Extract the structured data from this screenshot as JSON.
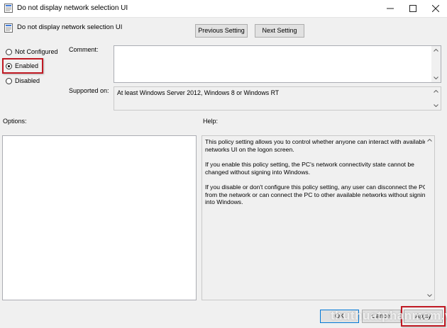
{
  "window": {
    "title": "Do not display network selection UI",
    "minimize_icon": "minimize-icon",
    "maximize_icon": "maximize-icon",
    "close_icon": "close-icon"
  },
  "header": {
    "policy_name": "Do not display network selection UI",
    "previous_setting_label": "Previous Setting",
    "next_setting_label": "Next Setting"
  },
  "state": {
    "options": [
      {
        "label": "Not Configured",
        "checked": false
      },
      {
        "label": "Enabled",
        "checked": true
      },
      {
        "label": "Disabled",
        "checked": false
      }
    ],
    "highlight_color": "#c01923"
  },
  "comment": {
    "label": "Comment:",
    "value": ""
  },
  "supported": {
    "label": "Supported on:",
    "value": "At least Windows Server 2012, Windows 8 or Windows RT"
  },
  "options_pane": {
    "label": "Options:"
  },
  "help": {
    "label": "Help:",
    "paragraphs": [
      "This policy setting allows you to control whether anyone can interact with available networks UI on the logon screen.",
      "If you enable this policy setting, the PC's network connectivity state cannot be changed without signing into Windows.",
      "If you disable or don't configure this policy setting, any user can disconnect the PC from the network or can connect the PC to other available networks without signing into Windows."
    ]
  },
  "footer": {
    "ok_label": "OK",
    "cancel_label": "Cancel",
    "apply_label": "Apply"
  },
  "watermark": {
    "text": "thuthuatphanmem.vn"
  }
}
